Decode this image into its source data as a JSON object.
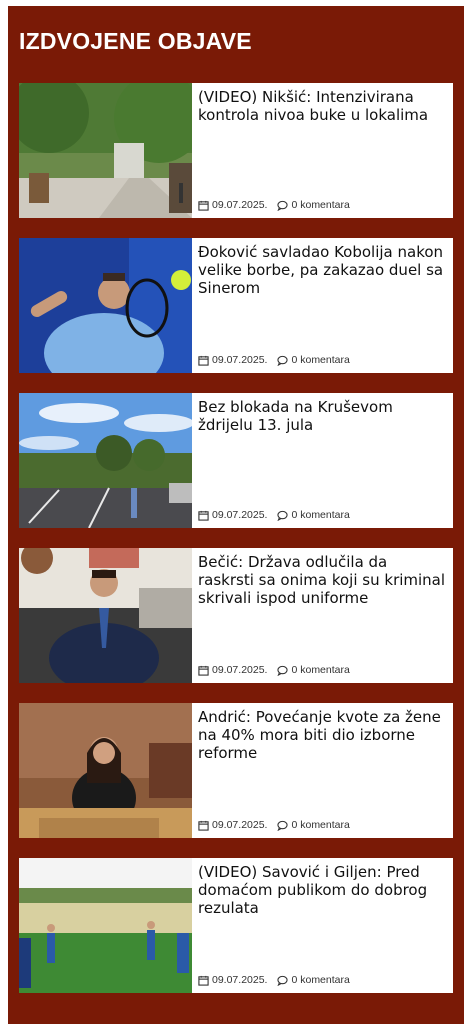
{
  "section": {
    "title": "IZDVOJENE OBJAVE"
  },
  "icons": {
    "date": "calendar-icon",
    "comments": "comment-icon"
  },
  "colors": {
    "background": "#7a1a06",
    "card": "#ffffff",
    "title": "#ffffff"
  },
  "posts": [
    {
      "title": "(VIDEO) Nikšić: Intenzivirana kontrola nivoa buke u lokalima",
      "date": "09.07.2025.",
      "comments": "0 komentara"
    },
    {
      "title": "Đoković savladao Kobolija nakon velike borbe, pa zakazao duel sa Sinerom",
      "date": "09.07.2025.",
      "comments": "0 komentara"
    },
    {
      "title": "Bez blokada na Kruševom ždrijelu 13. jula",
      "date": "09.07.2025.",
      "comments": "0 komentara"
    },
    {
      "title": "Bečić: Država odlučila da raskrsti sa onima koji su kriminal skrivali ispod uniforme",
      "date": "09.07.2025.",
      "comments": "0 komentara"
    },
    {
      "title": "Andrić: Povećanje kvote za žene na 40% mora biti dio izborne reforme",
      "date": "09.07.2025.",
      "comments": "0 komentara"
    },
    {
      "title": "(VIDEO) Savović i Giljen: Pred domaćom publikom do dobrog rezulata",
      "date": "09.07.2025.",
      "comments": "0 komentara"
    }
  ]
}
